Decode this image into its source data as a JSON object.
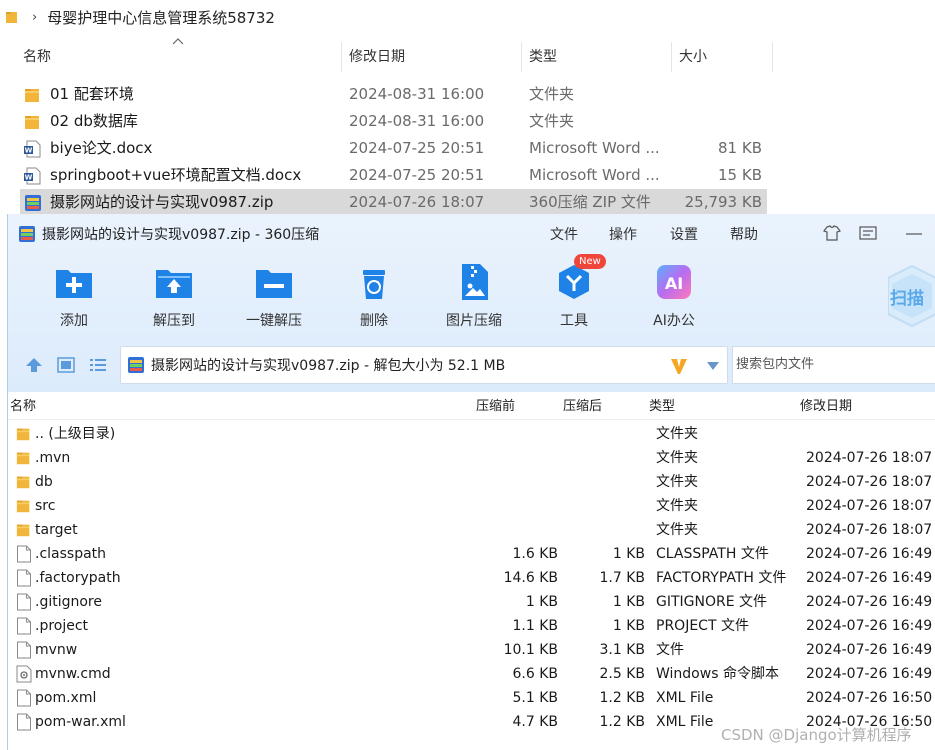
{
  "explorer": {
    "breadcrumb": "母婴护理中心信息管理系统58732",
    "columns": {
      "name": "名称",
      "date": "修改日期",
      "type": "类型",
      "size": "大小"
    },
    "rows": [
      {
        "name": "01 配套环境",
        "date": "2024-08-31 16:00",
        "type": "文件夹",
        "size": "",
        "icon": "folder-icon"
      },
      {
        "name": "02 db数据库",
        "date": "2024-08-31 16:00",
        "type": "文件夹",
        "size": "",
        "icon": "folder-icon"
      },
      {
        "name": "biye论文.docx",
        "date": "2024-07-25 20:51",
        "type": "Microsoft Word ...",
        "size": "81 KB",
        "icon": "word-doc-icon"
      },
      {
        "name": "springboot+vue环境配置文档.docx",
        "date": "2024-07-25 20:51",
        "type": "Microsoft Word ...",
        "size": "15 KB",
        "icon": "word-doc-icon"
      },
      {
        "name": "摄影网站的设计与实现v0987.zip",
        "date": "2024-07-26 18:07",
        "type": "360压缩 ZIP 文件",
        "size": "25,793 KB",
        "icon": "zip-archive-icon",
        "selected": true
      }
    ]
  },
  "zip": {
    "title": "摄影网站的设计与实现v0987.zip - 360压缩",
    "menu": [
      "文件",
      "操作",
      "设置",
      "帮助"
    ],
    "toolbar": [
      {
        "label": "添加",
        "icon": "add-icon"
      },
      {
        "label": "解压到",
        "icon": "extract-to-icon"
      },
      {
        "label": "一键解压",
        "icon": "one-click-extract-icon"
      },
      {
        "label": "删除",
        "icon": "delete-icon"
      },
      {
        "label": "图片压缩",
        "icon": "image-compress-icon"
      },
      {
        "label": "工具",
        "icon": "tools-icon",
        "badge": "New"
      },
      {
        "label": "AI办公",
        "icon": "ai-office-icon"
      }
    ],
    "scan_label": "扫描",
    "address": "摄影网站的设计与实现v0987.zip - 解包大小为 52.1 MB",
    "search_placeholder": "搜索包内文件",
    "columns": {
      "name": "名称",
      "before": "压缩前",
      "after": "压缩后",
      "type": "类型",
      "modified": "修改日期"
    },
    "rows": [
      {
        "name": ".. (上级目录)",
        "before": "",
        "after": "",
        "type": "文件夹",
        "modified": "",
        "icon": "folder-icon"
      },
      {
        "name": ".mvn",
        "before": "",
        "after": "",
        "type": "文件夹",
        "modified": "2024-07-26 18:07",
        "icon": "folder-icon"
      },
      {
        "name": "db",
        "before": "",
        "after": "",
        "type": "文件夹",
        "modified": "2024-07-26 18:07",
        "icon": "folder-icon"
      },
      {
        "name": "src",
        "before": "",
        "after": "",
        "type": "文件夹",
        "modified": "2024-07-26 18:07",
        "icon": "folder-icon"
      },
      {
        "name": "target",
        "before": "",
        "after": "",
        "type": "文件夹",
        "modified": "2024-07-26 18:07",
        "icon": "folder-icon"
      },
      {
        "name": ".classpath",
        "before": "1.6 KB",
        "after": "1 KB",
        "type": "CLASSPATH 文件",
        "modified": "2024-07-26 16:49",
        "icon": "file-icon"
      },
      {
        "name": ".factorypath",
        "before": "14.6 KB",
        "after": "1.7 KB",
        "type": "FACTORYPATH 文件",
        "modified": "2024-07-26 16:49",
        "icon": "file-icon"
      },
      {
        "name": ".gitignore",
        "before": "1 KB",
        "after": "1 KB",
        "type": "GITIGNORE 文件",
        "modified": "2024-07-26 16:49",
        "icon": "file-icon"
      },
      {
        "name": ".project",
        "before": "1.1 KB",
        "after": "1 KB",
        "type": "PROJECT 文件",
        "modified": "2024-07-26 16:49",
        "icon": "file-icon"
      },
      {
        "name": "mvnw",
        "before": "10.1 KB",
        "after": "3.1 KB",
        "type": "文件",
        "modified": "2024-07-26 16:49",
        "icon": "file-icon"
      },
      {
        "name": "mvnw.cmd",
        "before": "6.6 KB",
        "after": "2.5 KB",
        "type": "Windows 命令脚本",
        "modified": "2024-07-26 16:49",
        "icon": "cmd-script-icon"
      },
      {
        "name": "pom.xml",
        "before": "5.1 KB",
        "after": "1.2 KB",
        "type": "XML File",
        "modified": "2024-07-26 16:50",
        "icon": "file-icon"
      },
      {
        "name": "pom-war.xml",
        "before": "4.7 KB",
        "after": "1.2 KB",
        "type": "XML File",
        "modified": "2024-07-26 16:50",
        "icon": "file-icon"
      }
    ]
  },
  "watermark": "CSDN @Django计算机程序"
}
